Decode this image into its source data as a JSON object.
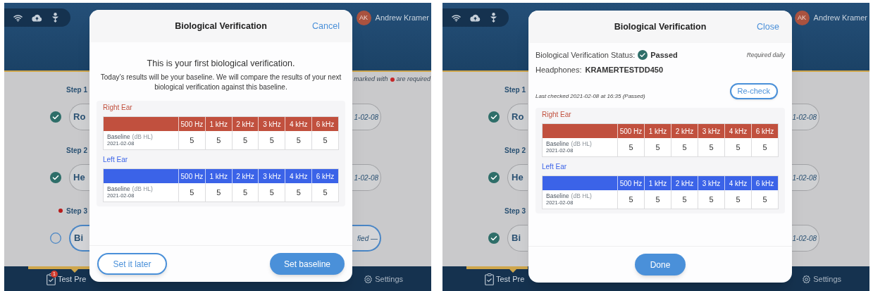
{
  "screens": [
    {
      "user": {
        "initials": "AK",
        "name": "Andrew Kramer"
      },
      "required_note": {
        "before": "marked with",
        "after": "are required"
      },
      "steps": [
        {
          "label": "Step 1",
          "required": false,
          "done": true,
          "selected": false,
          "button": "Ro",
          "date": "1-02-08"
        },
        {
          "label": "Step 2",
          "required": false,
          "done": true,
          "selected": false,
          "button": "He",
          "date": "1-02-08"
        },
        {
          "label": "Step 3",
          "required": true,
          "done": false,
          "selected": true,
          "button": "Bi",
          "date": "fied —"
        }
      ],
      "nav": [
        {
          "label": "Test Pre",
          "badge": "1",
          "selected": true
        },
        {
          "label": "Settings",
          "selected": false
        }
      ],
      "dialog": {
        "kind": "intro",
        "title": "Biological Verification",
        "action": "Cancel",
        "heading": "This is your first biological verification.",
        "message": "Today’s results will be your baseline. We will compare the results of your next biological verification against this baseline.",
        "ears": [
          {
            "label": "Right Ear",
            "color": "#c1503e",
            "columns": [
              "500 Hz",
              "1 kHz",
              "2 kHz",
              "3 kHz",
              "4 kHz",
              "6 kHz"
            ],
            "row": {
              "label": "Baseline",
              "unit": "(dB HL)",
              "date": "2021-02-08",
              "values": [
                "5",
                "5",
                "5",
                "5",
                "5",
                "5"
              ]
            }
          },
          {
            "label": "Left Ear",
            "color": "#3b63e8",
            "columns": [
              "500 Hz",
              "1 kHz",
              "2 kHz",
              "3 kHz",
              "4 kHz",
              "6 kHz"
            ],
            "row": {
              "label": "Baseline",
              "unit": "(dB HL)",
              "date": "2021-02-08",
              "values": [
                "5",
                "5",
                "5",
                "5",
                "5",
                "5"
              ]
            }
          }
        ],
        "buttons": [
          {
            "label": "Set it later",
            "kind": "outline"
          },
          {
            "label": "Set baseline",
            "kind": "primary"
          }
        ]
      }
    },
    {
      "user": {
        "initials": "AK",
        "name": "Andrew Kramer"
      },
      "steps": [
        {
          "label": "Step 1",
          "required": false,
          "done": true,
          "selected": false,
          "button": "Ro",
          "date": "1-02-08"
        },
        {
          "label": "Step 2",
          "required": false,
          "done": true,
          "selected": false,
          "button": "He",
          "date": "1-02-08"
        },
        {
          "label": "Step 3",
          "required": false,
          "done": true,
          "selected": false,
          "button": "Bi",
          "date": "1-02-08"
        }
      ],
      "nav": [
        {
          "label": "Test Pre",
          "selected": true
        },
        {
          "label": "Settings",
          "selected": false
        }
      ],
      "dialog": {
        "kind": "status",
        "title": "Biological Verification",
        "action": "Close",
        "status": {
          "label": "Biological Verification Status:",
          "value": "Passed",
          "passed": true
        },
        "note": "Required daily",
        "headphones": {
          "label": "Headphones:",
          "value": "KRAMERTESTDD450"
        },
        "last_checked": "Last checked 2021-02-08 at 16:35 (Passed)",
        "recheck": "Re-check",
        "ears": [
          {
            "label": "Right Ear",
            "color": "#c1503e",
            "columns": [
              "500 Hz",
              "1 kHz",
              "2 kHz",
              "3 kHz",
              "4 kHz",
              "6 kHz"
            ],
            "row": {
              "label": "Baseline",
              "unit": "(dB HL)",
              "date": "2021-02-08",
              "values": [
                "5",
                "5",
                "5",
                "5",
                "5",
                "5"
              ]
            }
          },
          {
            "label": "Left Ear",
            "color": "#3b63e8",
            "columns": [
              "500 Hz",
              "1 kHz",
              "2 kHz",
              "3 kHz",
              "4 kHz",
              "6 kHz"
            ],
            "row": {
              "label": "Baseline",
              "unit": "(dB HL)",
              "date": "2021-02-08",
              "values": [
                "5",
                "5",
                "5",
                "5",
                "5",
                "5"
              ]
            }
          }
        ],
        "buttons": [
          {
            "label": "Done",
            "kind": "primary"
          }
        ]
      }
    }
  ]
}
